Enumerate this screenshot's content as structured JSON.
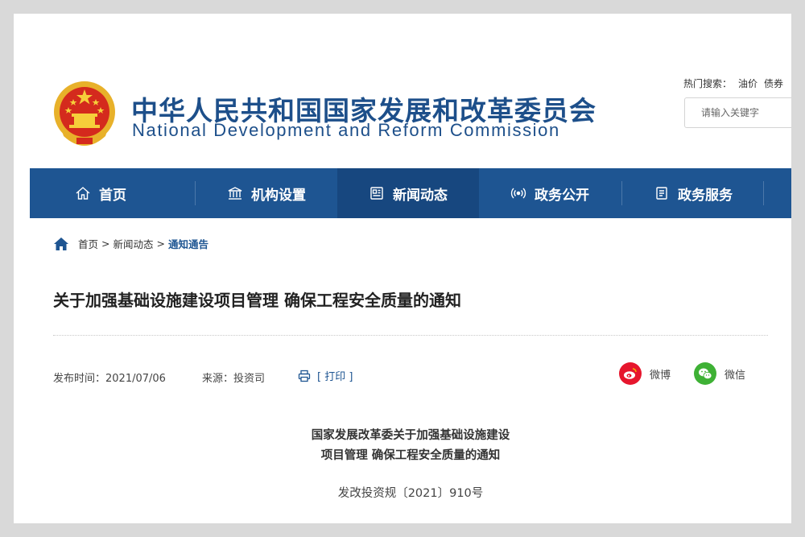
{
  "header": {
    "brand_cn": "中华人民共和国国家发展和改革委员会",
    "brand_en": "National Development and Reform Commission",
    "hot_search_label": "热门搜索：",
    "hot_search_terms": [
      "油价",
      "债券"
    ],
    "search_placeholder": "请输入关键字"
  },
  "nav": {
    "items": [
      {
        "label": "首页",
        "icon": "home-icon"
      },
      {
        "label": "机构设置",
        "icon": "institution-icon"
      },
      {
        "label": "新闻动态",
        "icon": "news-icon",
        "active": true
      },
      {
        "label": "政务公开",
        "icon": "broadcast-icon"
      },
      {
        "label": "政务服务",
        "icon": "document-icon"
      }
    ]
  },
  "breadcrumb": {
    "items": [
      "首页",
      "新闻动态",
      "通知通告"
    ],
    "separator": ">"
  },
  "article": {
    "title": "关于加强基础设施建设项目管理 确保工程安全质量的通知",
    "publish_time": "发布时间：2021/07/06",
    "source": "来源：投资司",
    "print_label": "[ 打印 ]",
    "share": [
      {
        "label": "微博",
        "icon": "weibo-icon",
        "color": "#e6162d"
      },
      {
        "label": "微信",
        "icon": "wechat-icon",
        "color": "#3eb135"
      }
    ],
    "doc_heading_line1": "国家发展改革委关于加强基础设施建设",
    "doc_heading_line2": "项目管理 确保工程安全质量的通知",
    "doc_number": "发改投资规〔2021〕910号"
  },
  "colors": {
    "brand_blue": "#1e5592",
    "nav_active": "#17477f"
  }
}
